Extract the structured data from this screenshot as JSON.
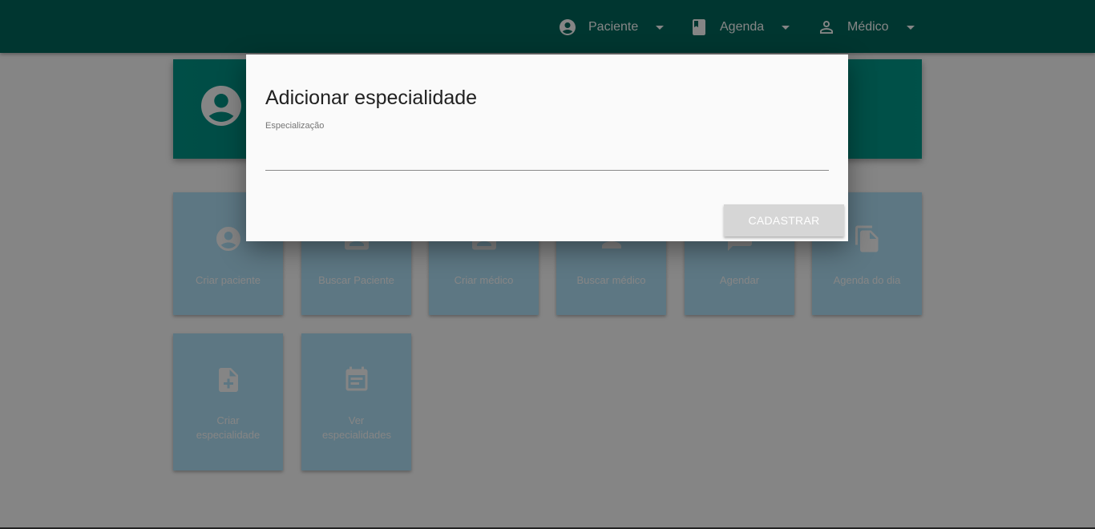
{
  "nav": {
    "items": [
      {
        "label": "Paciente",
        "icon": "account-circle-icon"
      },
      {
        "label": "Agenda",
        "icon": "book-icon"
      },
      {
        "label": "Médico",
        "icon": "person-outline-icon"
      }
    ]
  },
  "tiles": [
    {
      "label": "Criar paciente",
      "icon": "account-circle-icon"
    },
    {
      "label": "Buscar Paciente",
      "icon": "contact-card-icon"
    },
    {
      "label": "Criar médico",
      "icon": "contact-card-icon"
    },
    {
      "label": "Buscar médico",
      "icon": "person-icon"
    },
    {
      "label": "Agendar",
      "icon": "chat-icon"
    },
    {
      "label": "Agenda do dia",
      "icon": "file-copy-icon"
    },
    {
      "label": "Criar especialidade",
      "icon": "note-add-icon"
    },
    {
      "label": "Ver especialidades",
      "icon": "event-note-icon"
    }
  ],
  "dialog": {
    "title": "Adicionar especialidade",
    "field_label": "Especialização",
    "field_value": "",
    "submit_label": "CADASTRAR"
  },
  "colors": {
    "primary": "#00695c",
    "header_card": "#009688",
    "tile": "#b3e5fc",
    "overlay": "rgba(0,0,0,0.48)"
  }
}
